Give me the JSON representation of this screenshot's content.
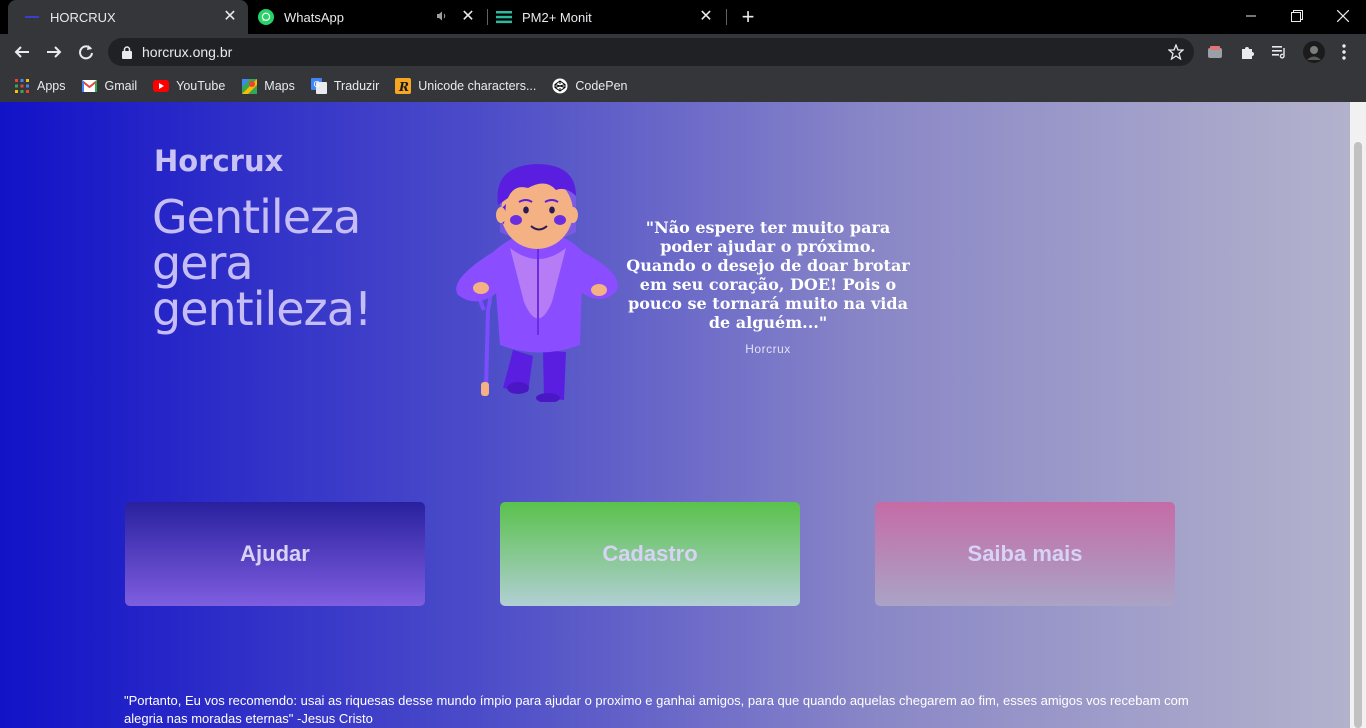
{
  "browser": {
    "tabs": [
      {
        "title": "HORCRUX",
        "active": true,
        "icon": "horcrux-favicon"
      },
      {
        "title": "WhatsApp",
        "active": false,
        "icon": "whatsapp-icon",
        "audio": true
      },
      {
        "title": "PM2+ Monit",
        "active": false,
        "icon": "pm2-icon"
      }
    ],
    "url": "horcrux.ong.br",
    "bookmarks": [
      {
        "label": "Apps",
        "icon": "apps-grid-icon"
      },
      {
        "label": "Gmail",
        "icon": "gmail-icon"
      },
      {
        "label": "YouTube",
        "icon": "youtube-icon"
      },
      {
        "label": "Maps",
        "icon": "maps-icon"
      },
      {
        "label": "Traduzir",
        "icon": "translate-icon"
      },
      {
        "label": "Unicode characters...",
        "icon": "unicode-icon"
      },
      {
        "label": "CodePen",
        "icon": "codepen-icon"
      }
    ]
  },
  "page": {
    "brand": "Horcrux",
    "headline": "Gentileza gera gentileza!",
    "quote": "\"Não espere ter muito para poder ajudar o próximo. Quando o desejo de doar brotar em seu coração, DOE! Pois o pouco se tornará muito na vida de alguém...\"",
    "quote_author": "Horcrux",
    "buttons": {
      "help": "Ajudar",
      "register": "Cadastro",
      "learn_more": "Saiba mais"
    },
    "footer_quote": "\"Portanto, Eu vos recomendo: usai as riquesas desse mundo ímpio para ajudar o proximo e ganhai amigos, para que quando aquelas chegarem ao fim, esses amigos vos recebam com alegria nas moradas eternas\" -Jesus Cristo"
  },
  "colors": {
    "page_gradient_start": "#1212c8",
    "page_gradient_end": "#b3b2cc",
    "help_button": "#28209e",
    "register_button": "#5ac24c",
    "learn_more_button": "#c56ba6"
  }
}
